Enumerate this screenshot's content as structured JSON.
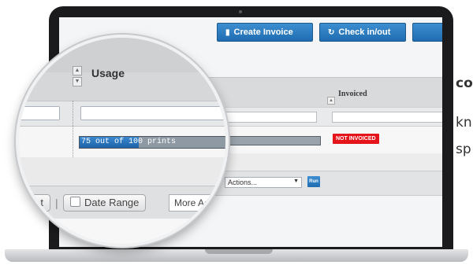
{
  "toolbar": {
    "create_invoice": "Create Invoice",
    "check_in_out": "Check in/out"
  },
  "table": {
    "columns": {
      "usage": "Usage",
      "invoiced": "Invoiced"
    },
    "row": {
      "usage_text": "75 out of 100 prints",
      "usage_fraction": 0.75,
      "invoiced_status": "NOT INVOICED"
    }
  },
  "footer": {
    "partial_button": "t",
    "date_range_label": "Date Range",
    "more_actions_label": "More Acti",
    "actions_select_value": "Actions...",
    "run_label": "Run"
  },
  "side_text": {
    "line1": "co",
    "line2": "kn",
    "line3": "sp"
  },
  "colors": {
    "accent": "#1f6db0",
    "status_red": "#e4141a"
  },
  "icons": {
    "create_invoice": "document-icon",
    "check_in_out": "refresh-icon",
    "sort": "sort-arrows-icon",
    "dropdown": "caret-down-icon"
  }
}
